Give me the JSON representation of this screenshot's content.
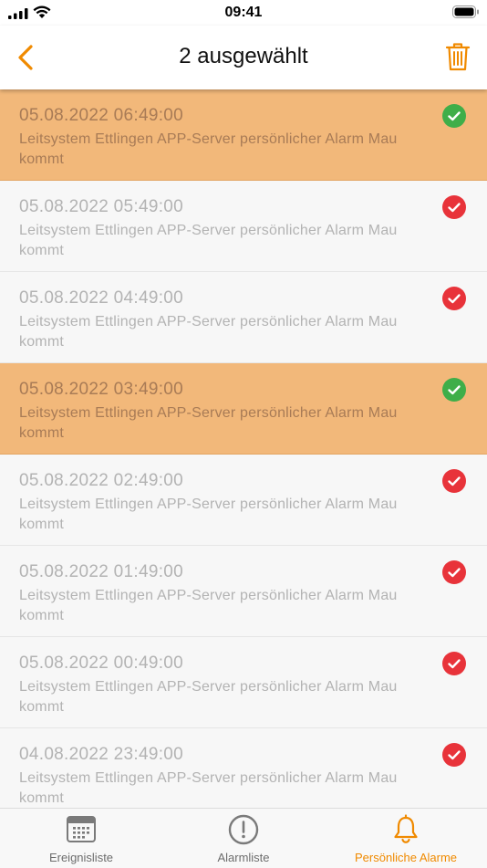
{
  "status_bar": {
    "time": "09:41"
  },
  "header": {
    "title": "2 ausgewählt",
    "back_icon": "chevron-left-icon",
    "delete_icon": "trash-icon"
  },
  "colors": {
    "accent": "#f08a00",
    "selected_row": "#f2b87a",
    "check_selected": "#3fae49",
    "check_default": "#e8333a"
  },
  "alarms": [
    {
      "datetime": "05.08.2022 06:49:00",
      "message": "Leitsystem Ettlingen APP-Server persönlicher Alarm Mau kommt",
      "selected": true
    },
    {
      "datetime": "05.08.2022 05:49:00",
      "message": "Leitsystem Ettlingen APP-Server persönlicher Alarm Mau kommt",
      "selected": false
    },
    {
      "datetime": "05.08.2022 04:49:00",
      "message": "Leitsystem Ettlingen APP-Server persönlicher Alarm Mau kommt",
      "selected": false
    },
    {
      "datetime": "05.08.2022 03:49:00",
      "message": "Leitsystem Ettlingen APP-Server persönlicher Alarm Mau kommt",
      "selected": true
    },
    {
      "datetime": "05.08.2022 02:49:00",
      "message": "Leitsystem Ettlingen APP-Server persönlicher Alarm Mau kommt",
      "selected": false
    },
    {
      "datetime": "05.08.2022 01:49:00",
      "message": "Leitsystem Ettlingen APP-Server persönlicher Alarm Mau kommt",
      "selected": false
    },
    {
      "datetime": "05.08.2022 00:49:00",
      "message": "Leitsystem Ettlingen APP-Server persönlicher Alarm Mau kommt",
      "selected": false
    },
    {
      "datetime": "04.08.2022 23:49:00",
      "message": "Leitsystem Ettlingen APP-Server persönlicher Alarm Mau kommt",
      "selected": false
    }
  ],
  "tabs": [
    {
      "label": "Ereignisliste",
      "icon": "calendar-icon",
      "active": false
    },
    {
      "label": "Alarmliste",
      "icon": "exclamation-circle-icon",
      "active": false
    },
    {
      "label": "Persönliche Alarme",
      "icon": "bell-icon",
      "active": true
    }
  ]
}
